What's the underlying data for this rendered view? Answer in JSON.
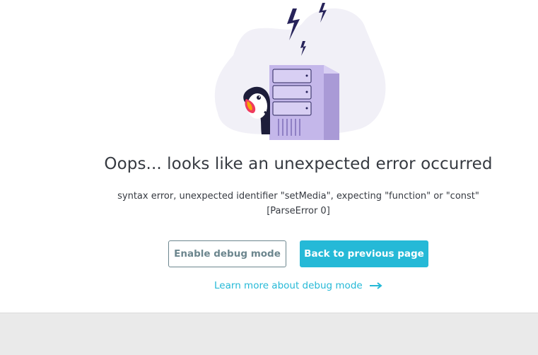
{
  "error": {
    "title": "Oops... looks like an unexpected error occurred",
    "message_line1": "syntax error, unexpected identifier \"setMedia\", expecting \"function\" or \"const\"",
    "message_line2": "[ParseError 0]"
  },
  "actions": {
    "debug_button_label": "Enable debug mode",
    "back_button_label": "Back to previous page",
    "learn_more_label": "Learn more about debug mode"
  },
  "icons": {
    "illustration": "server-error-illustration",
    "arrow": "arrow-right-icon"
  },
  "colors": {
    "accent": "#25b9d7",
    "text": "#363a41",
    "outline": "#6c868e",
    "server": "#c4b7ea",
    "blob": "#f1f0f7",
    "background": "#eaeaea"
  }
}
